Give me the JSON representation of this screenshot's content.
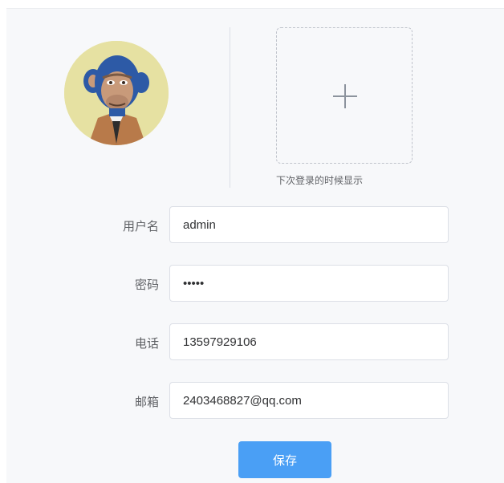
{
  "avatar": {
    "icon": "ape-avatar-icon"
  },
  "upload": {
    "icon": "plus-icon",
    "hint": "下次登录的时候显示"
  },
  "form": {
    "username": {
      "label": "用户名",
      "value": "admin"
    },
    "password": {
      "label": "密码",
      "value": "•••••"
    },
    "phone": {
      "label": "电话",
      "value": "13597929106"
    },
    "email": {
      "label": "邮箱",
      "value": "2403468827@qq.com"
    }
  },
  "actions": {
    "save_label": "保存"
  },
  "colors": {
    "primary": "#4a9ff5",
    "border": "#dcdfe6",
    "panel_bg": "#f7f8fa"
  }
}
